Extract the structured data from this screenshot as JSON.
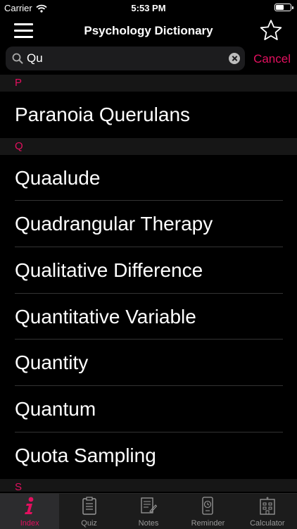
{
  "status_bar": {
    "carrier": "Carrier",
    "time": "5:53 PM",
    "battery_level": 0.55
  },
  "nav": {
    "title": "Psychology Dictionary"
  },
  "search": {
    "value": "Qu",
    "cancel_label": "Cancel"
  },
  "sections": [
    {
      "letter": "P",
      "items": [
        "Paranoia Querulans"
      ]
    },
    {
      "letter": "Q",
      "items": [
        "Quaalude",
        "Quadrangular Therapy",
        "Qualitative Difference",
        "Quantitative Variable",
        "Quantity",
        "Quantum",
        "Quota Sampling"
      ]
    },
    {
      "letter": "S",
      "items": []
    }
  ],
  "tabs": [
    {
      "label": "Index",
      "icon": "info-icon",
      "selected": true
    },
    {
      "label": "Quiz",
      "icon": "clipboard-icon",
      "selected": false
    },
    {
      "label": "Notes",
      "icon": "notes-icon",
      "selected": false
    },
    {
      "label": "Reminder",
      "icon": "reminder-icon",
      "selected": false
    },
    {
      "label": "Calculator",
      "icon": "calculator-icon",
      "selected": false
    }
  ],
  "colors": {
    "accent": "#e3105f",
    "background": "#000000",
    "section_bg": "#161616",
    "tab_bar_bg": "#1c1c1c"
  }
}
